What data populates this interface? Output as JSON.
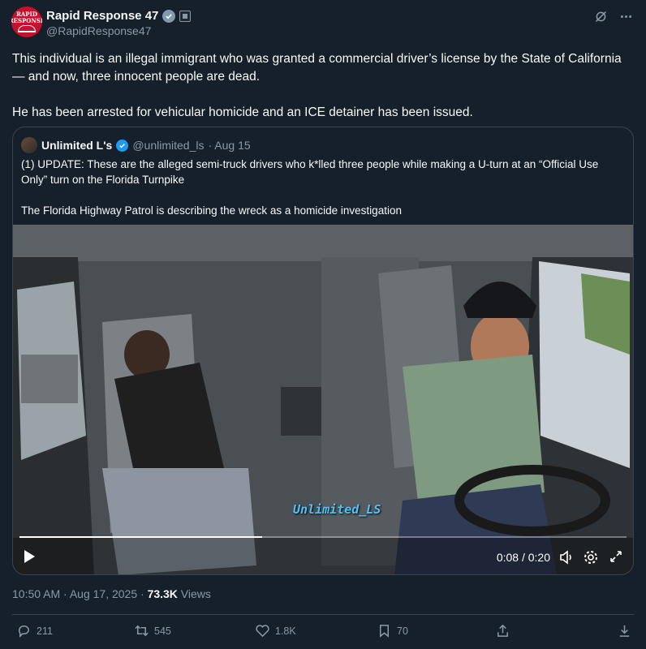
{
  "author": {
    "name": "Rapid Response 47",
    "handle": "@RapidResponse47",
    "avatar_text_1": "RAPID",
    "avatar_text_2": "RESPONSE"
  },
  "tweet": {
    "paragraph_1": "This individual is an illegal immigrant who was granted a commercial driver’s license by the State of California — and now, three innocent people are dead.",
    "paragraph_2": "He has been arrested for vehicular homicide and an ICE detainer has been issued."
  },
  "quoted": {
    "name": "Unlimited L's",
    "handle": "@unlimited_ls",
    "date": "· Aug 15",
    "paragraph_1": "(1) UPDATE: These are the alleged semi-truck drivers who k*lled three people while making a U-turn at an “Official Use Only” turn on the Florida Turnpike",
    "paragraph_2": "The Florida Highway Patrol is describing the wreck as a homicide investigation",
    "video": {
      "time": "0:08 / 0:20",
      "progress": 0.4,
      "watermark": "Unlimited_LS"
    }
  },
  "meta": {
    "time_date": "10:50 AM · Aug 17, 2025 · ",
    "views_count": "73.3K",
    "views_label": " Views"
  },
  "actions": {
    "replies": "211",
    "reposts": "545",
    "likes": "1.8K",
    "bookmarks": "70"
  },
  "colors": {
    "background": "#15202b",
    "text": "#f7f9f9",
    "muted": "#8b98a5",
    "border": "#38444d",
    "accent": "#1d9bf0"
  }
}
